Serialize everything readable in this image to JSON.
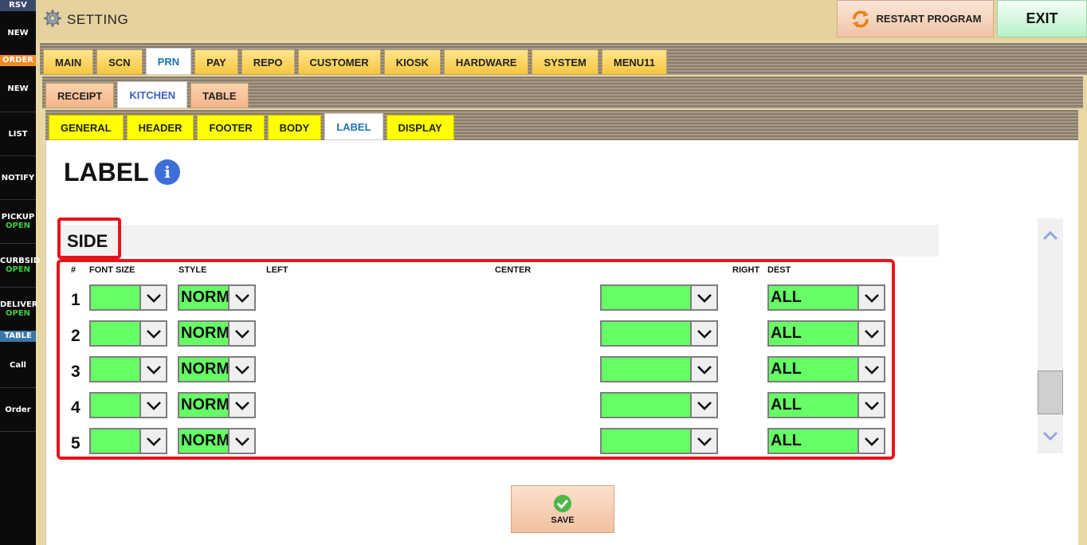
{
  "sidebar": {
    "rsv_header": "RSV",
    "rsv_new": "NEW",
    "order_header": "ORDER",
    "order_new": "NEW",
    "list": "LIST",
    "notify": "NOTIFY",
    "pickup": {
      "label": "PICKUP",
      "status": "OPEN"
    },
    "curbside": {
      "label": "CURBSID",
      "status": "OPEN"
    },
    "delivery": {
      "label": "DELIVER",
      "status": "OPEN"
    },
    "table_header": "TABLE",
    "call": "Call",
    "order": "Order"
  },
  "header": {
    "title": "SETTING",
    "restart_label": "RESTART PROGRAM",
    "exit_label": "EXIT"
  },
  "tabs_main": [
    {
      "label": "MAIN"
    },
    {
      "label": "SCN"
    },
    {
      "label": "PRN",
      "active": true
    },
    {
      "label": "PAY"
    },
    {
      "label": "REPO"
    },
    {
      "label": "CUSTOMER"
    },
    {
      "label": "KIOSK"
    },
    {
      "label": "HARDWARE"
    },
    {
      "label": "SYSTEM"
    },
    {
      "label": "MENU11"
    }
  ],
  "tabs_prn": [
    {
      "label": "RECEIPT"
    },
    {
      "label": "KITCHEN",
      "active": true
    },
    {
      "label": "TABLE"
    }
  ],
  "tabs_kitchen": [
    {
      "label": "GENERAL"
    },
    {
      "label": "HEADER"
    },
    {
      "label": "FOOTER"
    },
    {
      "label": "BODY"
    },
    {
      "label": "LABEL",
      "active": true
    },
    {
      "label": "DISPLAY"
    }
  ],
  "page": {
    "title": "LABEL",
    "info_icon": "info-circle-icon",
    "section_title": "SIDE"
  },
  "columns": {
    "num": "#",
    "font_size": "FONT SIZE",
    "style": "STYLE",
    "left": "LEFT",
    "center": "CENTER",
    "right": "RIGHT",
    "dest": "DEST"
  },
  "rows": [
    {
      "num": "1",
      "font_size": "",
      "style": "NORMAL",
      "right": "",
      "dest": "ALL"
    },
    {
      "num": "2",
      "font_size": "",
      "style": "NORMAL",
      "right": "",
      "dest": "ALL"
    },
    {
      "num": "3",
      "font_size": "",
      "style": "NORMAL",
      "right": "",
      "dest": "ALL"
    },
    {
      "num": "4",
      "font_size": "",
      "style": "NORMAL",
      "right": "",
      "dest": "ALL"
    },
    {
      "num": "5",
      "font_size": "",
      "style": "NORMAL",
      "right": "",
      "dest": "ALL"
    }
  ],
  "save_label": "SAVE",
  "colors": {
    "combo_bg": "#66ff66",
    "highlight": "#e8141c",
    "tab_yellow": "#ffff00",
    "sidebar_bg": "#0b0b0b",
    "open_status": "#3ccd3c"
  }
}
